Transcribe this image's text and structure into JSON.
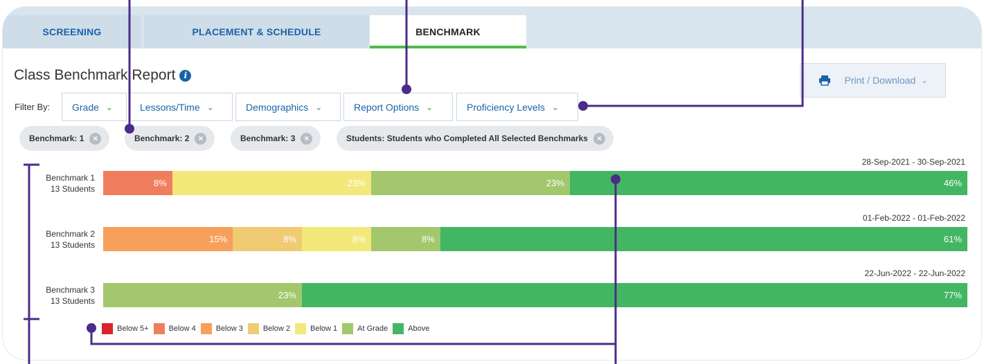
{
  "tabs": [
    {
      "label": "SCREENING"
    },
    {
      "label": "PLACEMENT & SCHEDULE"
    },
    {
      "label": "BENCHMARK"
    }
  ],
  "report": {
    "title": "Class Benchmark Report",
    "info_icon": "i"
  },
  "print": {
    "label": "Print / Download",
    "icon": "printer-icon"
  },
  "filters": {
    "label": "Filter By:",
    "dropdowns": [
      {
        "label": "Grade"
      },
      {
        "label": "Lessons/Time"
      },
      {
        "label": "Demographics"
      },
      {
        "label": "Report Options"
      },
      {
        "label": "Proficiency Levels"
      }
    ]
  },
  "chips": [
    {
      "label": "Benchmark: 1"
    },
    {
      "label": "Benchmark: 2"
    },
    {
      "label": "Benchmark: 3"
    },
    {
      "label": "Students: Students who Completed All Selected Benchmarks"
    }
  ],
  "benchmarks": [
    {
      "name": "Benchmark 1",
      "students": "13 Students",
      "date": "28-Sep-2021 - 30-Sep-2021",
      "segments": [
        {
          "level": "Below 4",
          "value": 8,
          "label": "8%"
        },
        {
          "level": "Below 1",
          "value": 23,
          "label": "23%"
        },
        {
          "level": "At Grade",
          "value": 23,
          "label": "23%"
        },
        {
          "level": "Above",
          "value": 46,
          "label": "46%"
        }
      ]
    },
    {
      "name": "Benchmark 2",
      "students": "13 Students",
      "date": "01-Feb-2022 - 01-Feb-2022",
      "segments": [
        {
          "level": "Below 3",
          "value": 15,
          "label": "15%"
        },
        {
          "level": "Below 2",
          "value": 8,
          "label": "8%"
        },
        {
          "level": "Below 1",
          "value": 8,
          "label": "8%"
        },
        {
          "level": "At Grade",
          "value": 8,
          "label": "8%"
        },
        {
          "level": "Above",
          "value": 61,
          "label": "61%"
        }
      ]
    },
    {
      "name": "Benchmark 3",
      "students": "13 Students",
      "date": "22-Jun-2022 - 22-Jun-2022",
      "segments": [
        {
          "level": "At Grade",
          "value": 23,
          "label": "23%"
        },
        {
          "level": "Above",
          "value": 77,
          "label": "77%"
        }
      ]
    }
  ],
  "legend": [
    {
      "label": "Below 5+",
      "color": "#d9242b"
    },
    {
      "label": "Below 4",
      "color": "#f07e5e"
    },
    {
      "label": "Below 3",
      "color": "#f6a05c"
    },
    {
      "label": "Below 2",
      "color": "#f0cb73"
    },
    {
      "label": "Below 1",
      "color": "#f3e97b"
    },
    {
      "label": "At Grade",
      "color": "#a3c76d"
    },
    {
      "label": "Above",
      "color": "#43b663"
    }
  ],
  "colors": {
    "accent": "#1a63a8",
    "annotation": "#4a2c8a",
    "tab_active_underline": "#52b848"
  }
}
